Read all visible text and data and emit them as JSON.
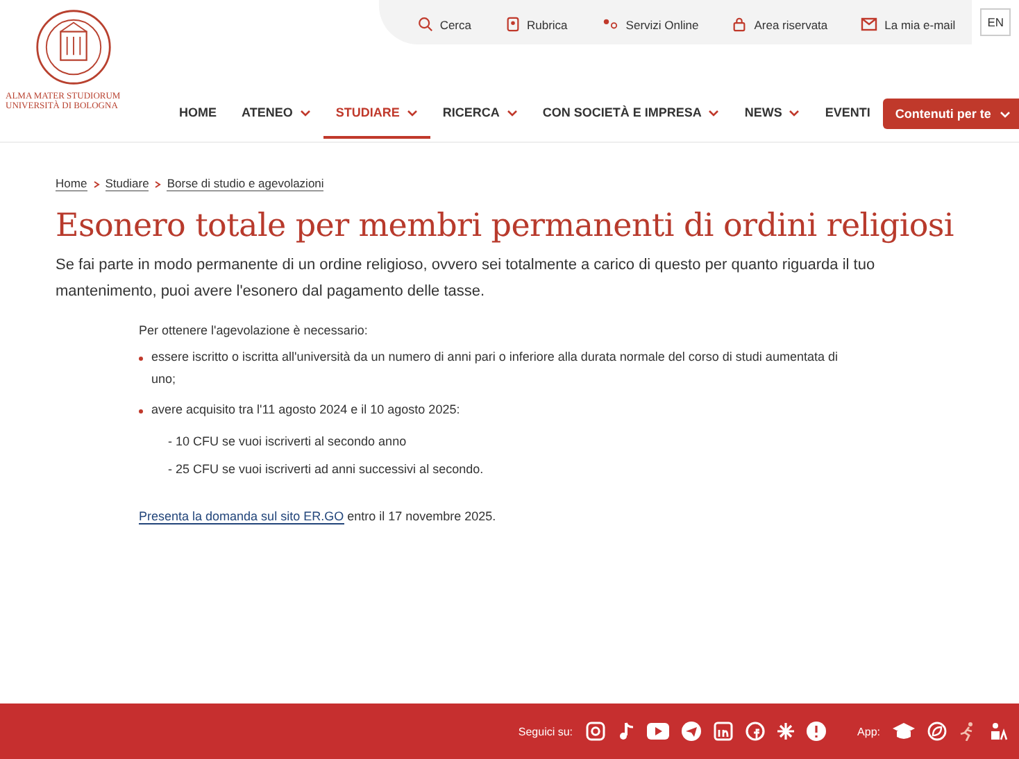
{
  "header": {
    "logo_text": [
      "ALMA MATER STUDIORUM",
      "UNIVERSITÀ DI BOLOGNA"
    ],
    "utility_links": [
      {
        "kind": "search",
        "label": "Cerca"
      },
      {
        "kind": "book",
        "label": "Rubrica"
      },
      {
        "kind": "services",
        "label": "Servizi Online"
      },
      {
        "kind": "lock",
        "label": "Area riservata"
      },
      {
        "kind": "mail",
        "label": "La mia e-mail"
      }
    ],
    "language_button": "EN",
    "nav": [
      {
        "label": "HOME",
        "dropdown": false,
        "selected": false
      },
      {
        "label": "ATENEO",
        "dropdown": true,
        "selected": false
      },
      {
        "label": "STUDIARE",
        "dropdown": true,
        "selected": true
      },
      {
        "label": "RICERCA",
        "dropdown": true,
        "selected": false
      },
      {
        "label": "CON SOCIETÀ E IMPRESA",
        "dropdown": true,
        "selected": false
      },
      {
        "label": "NEWS",
        "dropdown": true,
        "selected": false
      },
      {
        "label": "EVENTI",
        "dropdown": false,
        "selected": false
      }
    ],
    "menu_button": "Contenuti per te"
  },
  "breadcrumb": [
    "Home",
    "Studiare",
    "Borse di studio e agevolazioni"
  ],
  "title": "Esonero totale per membri permanenti di ordini religiosi",
  "intro": "Se fai parte in modo permanente di un ordine religioso, ovvero sei totalmente a carico di questo per quanto riguarda il tuo mantenimento, puoi avere l'esonero dal pagamento delle tasse.",
  "requirements": {
    "lead": "Per ottenere l'agevolazione è necessario:",
    "items": [
      {
        "text": "essere iscritto o iscritta all'università da un numero di anni pari o inferiore alla durata normale del corso di studi aumentata di uno;"
      },
      {
        "text": "avere acquisito tra l'11 agosto 2024 e il 10 agosto 2025:",
        "children": [
          "- 10 CFU  se vuoi iscriverti al secondo anno",
          "- 25 CFU se vuoi iscriverti ad anni successivi al secondo."
        ]
      }
    ]
  },
  "application": {
    "link": "Presenta la domanda sul sito ER.GO",
    "rest": "entro il 17 novembre 2025."
  },
  "footer": {
    "follow_label": "Seguici su:",
    "app_label": "App:"
  }
}
